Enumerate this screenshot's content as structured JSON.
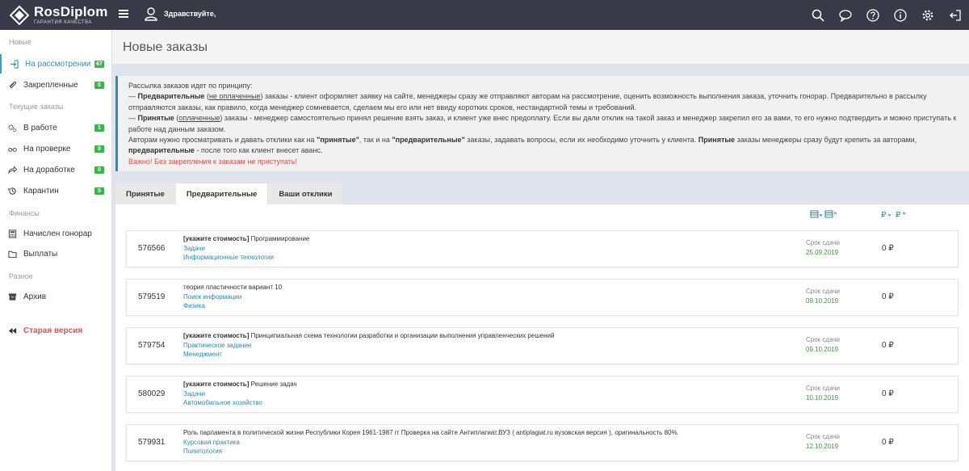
{
  "brand": {
    "title": "RosDiplom",
    "subtitle": "ГАРАНТИЯ КАЧЕСТВА"
  },
  "header": {
    "greeting": "Здравствуйте,"
  },
  "sidebar": {
    "sections": [
      {
        "label": "Новые"
      },
      {
        "label": "Текущие заказы"
      },
      {
        "label": "Финансы"
      },
      {
        "label": "Разное"
      }
    ],
    "items": [
      {
        "label": "На рассмотрении",
        "badge": "67",
        "icon": "login-arrow-icon"
      },
      {
        "label": "Закрепленные",
        "badge": "0",
        "icon": "paperclip-icon"
      },
      {
        "label": "В работе",
        "badge": "1",
        "icon": "gears-icon"
      },
      {
        "label": "На проверке",
        "badge": "0",
        "icon": "glasses-icon"
      },
      {
        "label": "На доработке",
        "badge": "0",
        "icon": "share-arrow-icon"
      },
      {
        "label": "Карантин",
        "badge": "5",
        "icon": "history-icon"
      },
      {
        "label": "Начислен гонорар",
        "icon": "calculator-icon"
      },
      {
        "label": "Выплаты",
        "icon": "folder-icon"
      },
      {
        "label": "Архив",
        "icon": "archive-icon"
      },
      {
        "label": "Старая версия",
        "icon": "fast-backward-icon"
      }
    ]
  },
  "page": {
    "title": "Новые заказы"
  },
  "info": {
    "intro": "Рассылка заказов идет по принципу:",
    "p1_dash": "— ",
    "p1_bold": "Предварительные",
    "p1_paren_open": " (",
    "p1_under": "не оплаченные",
    "p1_rest": ") заказы - клиент оформляет заявку на сайте, менеджеры сразу же отправляют авторам на рассмотрение, оценить возможность выполнения заказа, уточнить гонорар. Предварительно в рассылку отправляются заказы, как правило, когда менеджер сомневается, сделаем мы его или нет ввиду коротких сроков, нестандартной темы и требований.",
    "p2_dash": "— ",
    "p2_bold": "Принятые",
    "p2_paren_open": " (",
    "p2_under": "оплаченные",
    "p2_rest": ") заказы - менеджер самостоятельно принял решение взять заказ, и клиент уже внес предоплату. Если вы дали отклик на такой заказ и менеджер закрепил его за вами, то его нужно подтвердить и можно приступать к работе над данным заказом.",
    "p3_a": "Авторам нужно просматривать и давать отклики как на ",
    "p3_b": "\"принятые\"",
    "p3_c": ", так и на ",
    "p3_d": "\"предварительные\"",
    "p3_e": " заказы, задавать вопросы, если их необходимо уточнить у клиента. ",
    "p3_f": "Принятые",
    "p3_g": " заказы менеджеры сразу будут крепить за авторами, ",
    "p3_h": "предварительные",
    "p3_i": " - после того как клиент внесет аванс.",
    "warning": "Важно! Без закрепления к заказам не приступать!"
  },
  "tabs": [
    {
      "label": "Принятые"
    },
    {
      "label": "Предварительные"
    },
    {
      "label": "Ваши отклики"
    }
  ],
  "orders": [
    {
      "id": "576566",
      "title_tag": "[укажите стоимость]",
      "title": " Программирование",
      "type": "Задачи",
      "subject": "Информационные технологии",
      "due_label": "Срок сдачи",
      "due": "25.09.2019",
      "price": "0 ₽"
    },
    {
      "id": "579519",
      "title_tag": "",
      "title": "теория пластичности вариант 10",
      "type": "Поиск информации",
      "subject": "Физика",
      "due_label": "Срок сдачи",
      "due": "09.10.2019",
      "price": "0 ₽"
    },
    {
      "id": "579754",
      "title_tag": "[укажите стоимость]",
      "title": " Принципиальная схема технологии разработки и организации выполнения управленческих решений",
      "type": "Практическое задание",
      "subject": "Менеджмент",
      "due_label": "Срок сдачи",
      "due": "09.10.2019",
      "price": "0 ₽"
    },
    {
      "id": "580029",
      "title_tag": "[укажите стоимость]",
      "title": " Решение задач",
      "type": "Задачи",
      "subject": "Автомобильное хозяйство",
      "due_label": "Срок сдачи",
      "due": "10.10.2019",
      "price": "0 ₽"
    },
    {
      "id": "579931",
      "title_tag": "",
      "title": "Роль парламента в политической жизни Республики Корея 1961-1987 гг Проверка на сайте Антиплагиат.ВУЗ ( antiplagiat.ru вузовская версия ), оригинальность 80%.",
      "type": "Курсовая практика",
      "subject": "Политология",
      "due_label": "Срок сдачи",
      "due": "12.10.2019",
      "price": "0 ₽"
    }
  ],
  "colors": {
    "topbar": "#383b47",
    "accent": "#2596be",
    "badge": "#3bb54a",
    "warning": "#d9534f",
    "due_date": "#3a9b3a"
  }
}
